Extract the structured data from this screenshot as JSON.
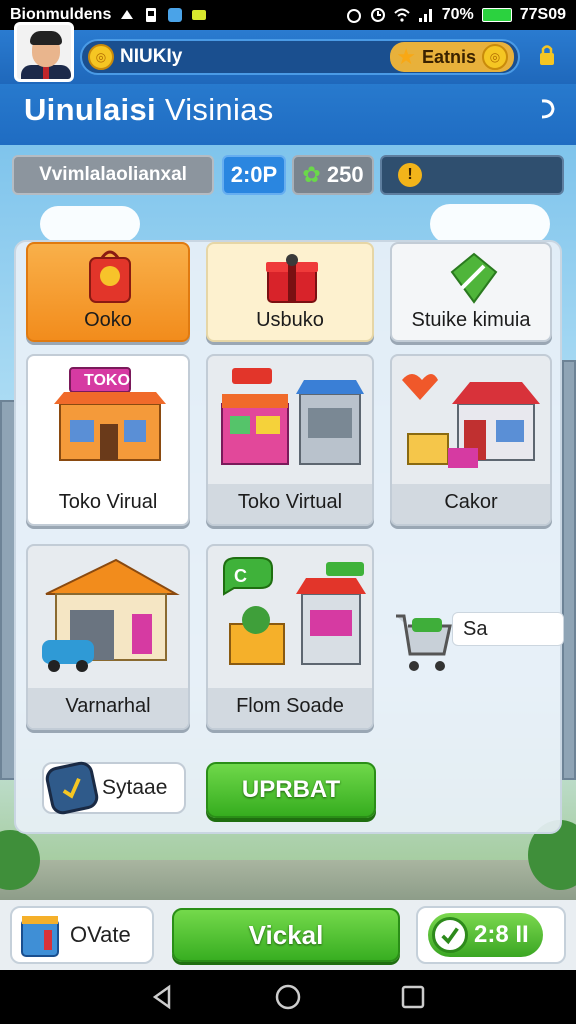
{
  "status_bar": {
    "carrier": "Bionmuldens",
    "battery_pct": "70%",
    "time": "77S09"
  },
  "header": {
    "player_name": "NIUKIy",
    "currency_label": "Eatnis",
    "title_bold": "Uinulaisi",
    "title_light": "Visinias"
  },
  "stats": {
    "name": "Vvimlalaolianxal",
    "time": "2:0P",
    "gems": "250",
    "info": "!"
  },
  "tiles": [
    {
      "label": "Ooko"
    },
    {
      "label": "Usbuko"
    },
    {
      "label": "Stuike kimuia"
    },
    {
      "label": "Toko Virual",
      "sign": "TOKO"
    },
    {
      "label": "Toko Virtual"
    },
    {
      "label": "Cakor"
    },
    {
      "label": "Varnarhal"
    },
    {
      "label": "Flom Soade",
      "badge": "C"
    }
  ],
  "cart": {
    "label": "Sa"
  },
  "actions": {
    "sytaae": "Sytaae",
    "upgrade": "UPRBAT"
  },
  "bottom": {
    "owate": "OVate",
    "vickal": "Vickal",
    "score": "2:8 II"
  },
  "colors": {
    "header_blue": "#1f6cc2",
    "accent_green": "#38ae21",
    "accent_orange": "#f28c1c"
  }
}
